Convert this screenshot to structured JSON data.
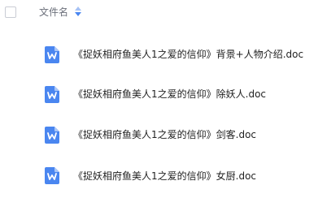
{
  "header": {
    "column_label": "文件名",
    "sort_icon": "sort-icon"
  },
  "files": [
    {
      "name": "《捉妖相府鱼美人1之爱的信仰》背景+人物介绍.doc",
      "icon": "word-doc-icon"
    },
    {
      "name": "《捉妖相府鱼美人1之爱的信仰》除妖人.doc",
      "icon": "word-doc-icon"
    },
    {
      "name": "《捉妖相府鱼美人1之爱的信仰》剑客.doc",
      "icon": "word-doc-icon"
    },
    {
      "name": "《捉妖相府鱼美人1之爱的信仰》女厨.doc",
      "icon": "word-doc-icon"
    }
  ],
  "colors": {
    "word_blue": "#4a86f0",
    "sort_up": "#a7c2f5",
    "sort_down": "#4a86f0"
  }
}
